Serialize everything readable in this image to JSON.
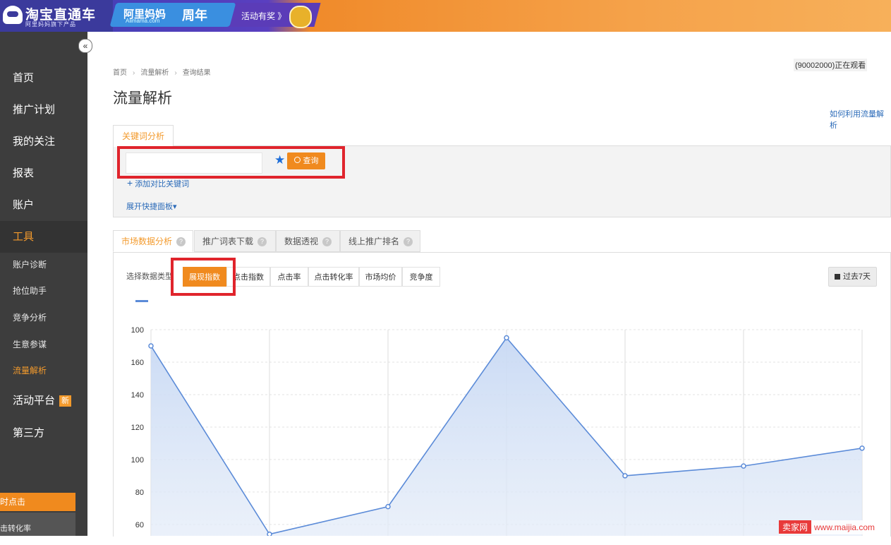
{
  "header": {
    "logo_title": "淘宝直通车",
    "logo_subtitle": "阿里妈妈旗下产品",
    "banner_brand": "阿里妈妈",
    "banner_brand_sub": "Alimama.com",
    "banner_year": "周年",
    "banner_activity": "活动有奖 》"
  },
  "sidebar": {
    "collapse_symbol": "«",
    "main_items": [
      "首页",
      "推广计划",
      "我的关注",
      "报表",
      "账户",
      "工具"
    ],
    "tool_subitems": [
      "账户诊断",
      "抢位助手",
      "竞争分析",
      "生意参谋",
      "流量解析"
    ],
    "activity_label": "活动平台",
    "new_badge": "新",
    "third_party": "第三方",
    "bottom_orange": "时点击",
    "bottom_grey": "击转化率"
  },
  "breadcrumb": {
    "items": [
      "首页",
      "流量解析",
      "查询结果"
    ],
    "sep": "›"
  },
  "viewing_notice": "(90002000)正在观看",
  "page_title": "流量解析",
  "help_link": "如何利用流量解析",
  "keyword_tab": "关键词分析",
  "search": {
    "value": "",
    "placeholder": "",
    "query_label": "查询"
  },
  "add_compare": "添加对比关键词",
  "expand_panel": "展开快捷面板▾",
  "analysis_tabs": [
    "市场数据分析",
    "推广词表下载",
    "数据透视",
    "线上推广排名"
  ],
  "data_type_label": "选择数据类型",
  "data_types": [
    "展现指数",
    "点击指数",
    "点击率",
    "点击转化率",
    "市场均价",
    "竞争度"
  ],
  "period_label": "过去7天",
  "colors": {
    "accent": "#f08a1e",
    "link": "#2a6ab8",
    "highlight_box": "#e0242c",
    "line": "#5b8bd8"
  },
  "chart_data": {
    "type": "area",
    "series": [
      {
        "values": [
          170,
          54,
          71,
          175,
          90,
          96,
          107
        ]
      }
    ],
    "y_ticks": [
      60,
      80,
      100,
      120,
      140,
      160,
      180
    ],
    "y_tick_labels": [
      "60",
      "80",
      "100",
      "120",
      "140",
      "160",
      "100"
    ],
    "ylim": [
      53,
      180
    ],
    "grid": true
  },
  "watermark": {
    "logo": "卖家网",
    "url": "www.maijia.com"
  }
}
